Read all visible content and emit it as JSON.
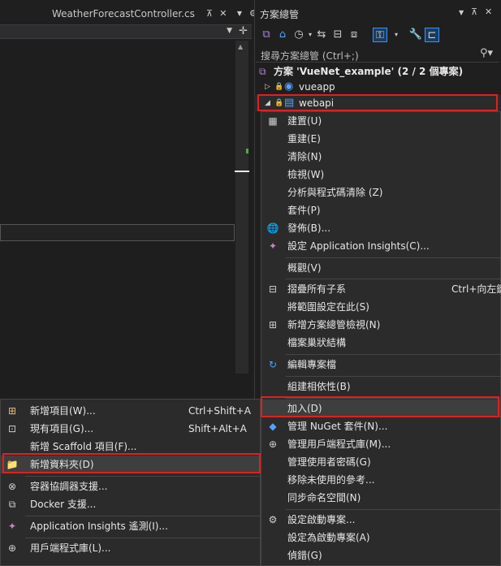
{
  "editor": {
    "tab_title": "WeatherForecastController.cs",
    "tab_pin_icon": "pin-icon",
    "tab_close_icon": "close-icon"
  },
  "solution_explorer": {
    "title": "方案總管",
    "search_placeholder": "搜尋方案總管 (Ctrl+;)",
    "tree": {
      "solution": "方案 'VueNet_example' (2 / 2 個專案)",
      "vueapp": "vueapp",
      "webapi": "webapi"
    }
  },
  "project_menu": {
    "items": [
      {
        "label": "建置(U)",
        "icon": "build-icon"
      },
      {
        "label": "重建(E)",
        "icon": ""
      },
      {
        "label": "清除(N)",
        "icon": ""
      },
      {
        "label": "檢視(W)",
        "icon": ""
      },
      {
        "label": "分析與程式碼清除 (Z)",
        "icon": ""
      },
      {
        "label": "套件(P)",
        "icon": ""
      },
      {
        "label": "發佈(B)...",
        "icon": "publish-globe-icon"
      },
      {
        "label": "設定 Application Insights(C)...",
        "icon": "insights-icon"
      },
      {
        "label": "概觀(V)",
        "icon": ""
      },
      {
        "label": "摺疊所有子系",
        "icon": "collapse-icon",
        "shortcut": "Ctrl+向左鍵"
      },
      {
        "label": "將範圍設定在此(S)",
        "icon": ""
      },
      {
        "label": "新增方案總管檢視(N)",
        "icon": "new-view-icon"
      },
      {
        "label": "檔案巢狀結構",
        "icon": ""
      },
      {
        "label": "編輯專案檔",
        "icon": "edit-project-icon"
      },
      {
        "label": "組建相依性(B)",
        "icon": ""
      },
      {
        "label": "加入(D)",
        "icon": ""
      },
      {
        "label": "管理 NuGet 套件(N)...",
        "icon": "nuget-icon"
      },
      {
        "label": "管理用戶端程式庫(M)...",
        "icon": "client-library-icon"
      },
      {
        "label": "管理使用者密碼(G)",
        "icon": ""
      },
      {
        "label": "移除未使用的參考...",
        "icon": ""
      },
      {
        "label": "同步命名空間(N)",
        "icon": ""
      },
      {
        "label": "設定啟動專案...",
        "icon": "gear-icon"
      },
      {
        "label": "設定為啟動專案(A)",
        "icon": ""
      },
      {
        "label": "偵錯(G)",
        "icon": ""
      }
    ]
  },
  "add_submenu": {
    "items": [
      {
        "label": "新增項目(W)...",
        "shortcut": "Ctrl+Shift+A",
        "icon": "new-item-icon"
      },
      {
        "label": "現有項目(G)...",
        "shortcut": "Shift+Alt+A",
        "icon": "existing-item-icon"
      },
      {
        "label": "新增 Scaffold 項目(F)...",
        "shortcut": "",
        "icon": ""
      },
      {
        "label": "新增資料夾(D)",
        "shortcut": "",
        "icon": "new-folder-icon"
      },
      {
        "label": "容器協調器支援...",
        "shortcut": "",
        "icon": "container-icon"
      },
      {
        "label": "Docker 支援...",
        "shortcut": "",
        "icon": "docker-icon"
      },
      {
        "label": "Application Insights 遙測(I)...",
        "shortcut": "",
        "icon": "insights-icon"
      },
      {
        "label": "用戶端程式庫(L)...",
        "shortcut": "",
        "icon": "client-library-icon"
      }
    ]
  },
  "colors": {
    "highlight_border": "#e02020",
    "accent": "#3794ff"
  }
}
